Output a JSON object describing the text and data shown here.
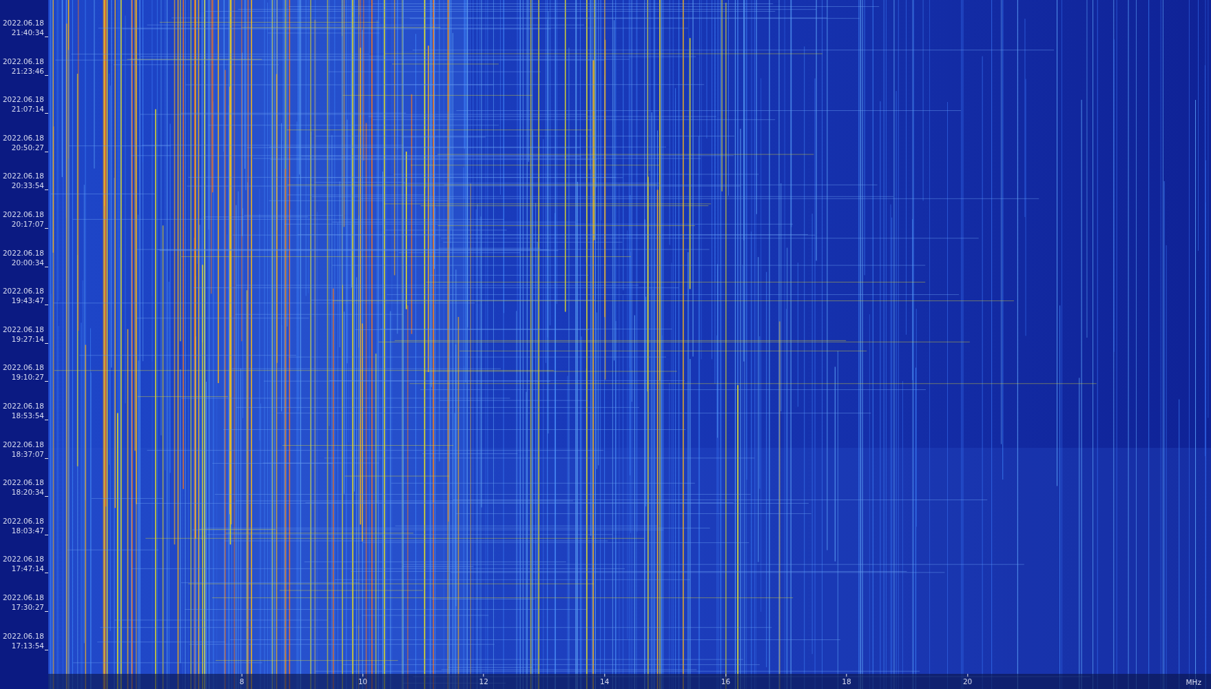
{
  "time_axis": {
    "labels": [
      {
        "date": "2022.06.18",
        "time": "21:40:34"
      },
      {
        "date": "2022.06.18",
        "time": "21:23:46"
      },
      {
        "date": "2022.06.18",
        "time": "21:07:14"
      },
      {
        "date": "2022.06.18",
        "time": "20:50:27"
      },
      {
        "date": "2022.06.18",
        "time": "20:33:54"
      },
      {
        "date": "2022.06.18",
        "time": "20:17:07"
      },
      {
        "date": "2022.06.18",
        "time": "20:00:34"
      },
      {
        "date": "2022.06.18",
        "time": "19:43:47"
      },
      {
        "date": "2022.06.18",
        "time": "19:27:14"
      },
      {
        "date": "2022.06.18",
        "time": "19:10:27"
      },
      {
        "date": "2022.06.18",
        "time": "18:53:54"
      },
      {
        "date": "2022.06.18",
        "time": "18:37:07"
      },
      {
        "date": "2022.06.18",
        "time": "18:20:34"
      },
      {
        "date": "2022.06.18",
        "time": "18:03:47"
      },
      {
        "date": "2022.06.18",
        "time": "17:47:14"
      },
      {
        "date": "2022.06.18",
        "time": "17:30:27"
      },
      {
        "date": "2022.06.18",
        "time": "17:13:54"
      }
    ]
  },
  "frequency_axis": {
    "ticks": [
      "8",
      "10",
      "12",
      "14",
      "16",
      "18",
      "20"
    ],
    "unit": "MHz"
  }
}
